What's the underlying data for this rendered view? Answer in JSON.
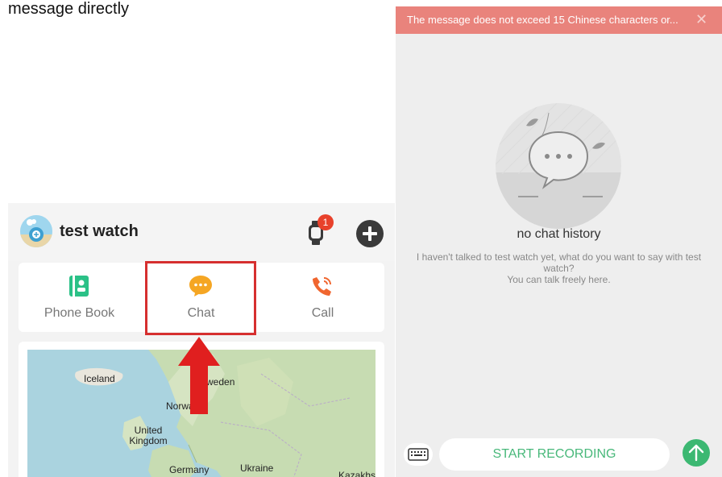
{
  "left": {
    "top_text": "message directly",
    "header": {
      "device_name": "test watch",
      "notification_count": "1"
    },
    "functions": [
      {
        "label": "Phone Book",
        "icon": "phone-book-icon",
        "color": "#2bc187"
      },
      {
        "label": "Chat",
        "icon": "chat-bubble-icon",
        "color": "#f5a623"
      },
      {
        "label": "Call",
        "icon": "phone-call-icon",
        "color": "#f0662f"
      }
    ],
    "map_labels": [
      "Iceland",
      "Sweden",
      "Norway",
      "United Kingdom",
      "Germany",
      "Ukraine",
      "Kazakhs"
    ]
  },
  "right": {
    "notice": "The message does not exceed 15 Chinese characters or...",
    "empty_title": "no chat history",
    "empty_desc_line1": "I haven't talked to test watch yet, what do you want to say with test",
    "empty_desc_line2": "watch?",
    "empty_desc_line3": "You can talk freely here.",
    "record_label": "START RECORDING"
  },
  "colors": {
    "accent_green": "#3cb872",
    "notice_bg": "#e9837c",
    "highlight_red": "#d62f2f"
  }
}
